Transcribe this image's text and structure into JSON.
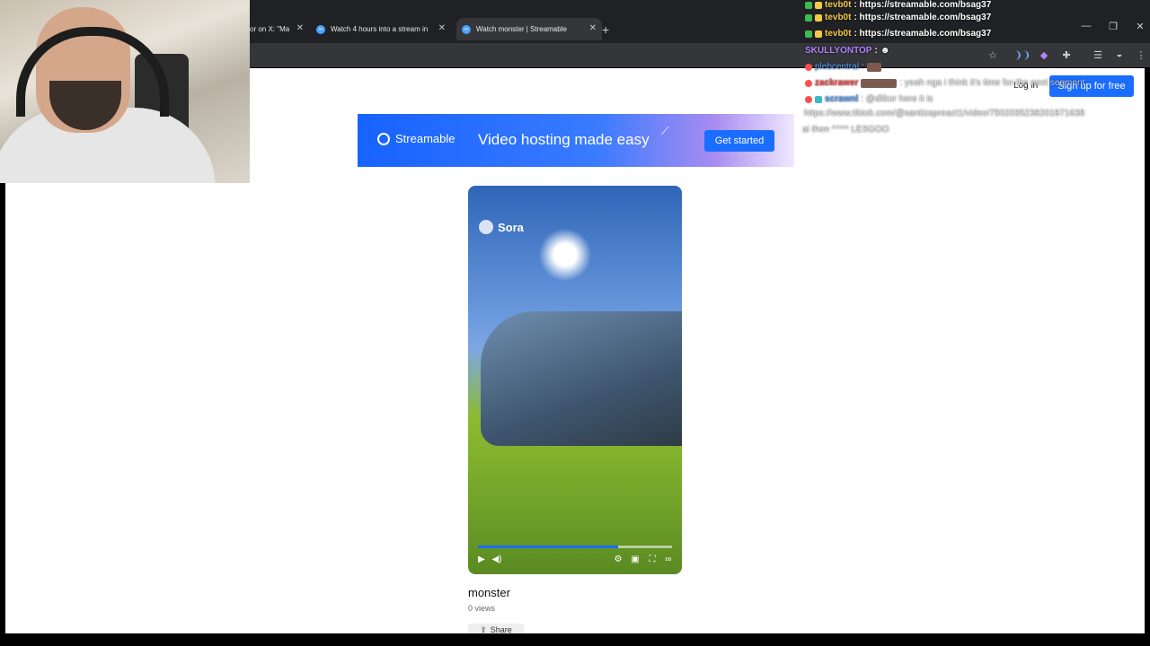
{
  "browser": {
    "tabs": [
      {
        "title": "or on X: \"Ma"
      },
      {
        "title": "Watch 4 hours into a stream in"
      },
      {
        "title": "Watch monster | Streamable"
      }
    ],
    "new_tab_label": "+",
    "window_controls": {
      "minimize": "—",
      "maximize": "❐",
      "close": "✕"
    }
  },
  "banner": {
    "brand": "Streamable",
    "tagline": "Video hosting made easy",
    "cta": "Get started"
  },
  "auth": {
    "login": "Log in",
    "signup": "Sign up for free"
  },
  "video": {
    "watermark": "Sora",
    "title": "monster",
    "views": "0 views",
    "share": "Share",
    "progress_fraction": 0.72
  },
  "chat": {
    "lines": [
      {
        "user": "tevb0t",
        "msg": ": https://streamable.com/bsag37"
      },
      {
        "user": "tevb0t",
        "msg": ": https://streamable.com/bsag37"
      },
      {
        "user": "tevb0t",
        "msg": ": https://streamable.com/bsag37"
      },
      {
        "user": "SKULLYONTOP",
        "msg": ":"
      },
      {
        "user": "plebcentral",
        "msg": ":"
      },
      {
        "user": "zackrawer",
        "msg": ": yeah nga i think it's time for the next segment"
      },
      {
        "user": "scrawnl",
        "msg": ": @dlikor here it is"
      },
      {
        "user": "",
        "msg": "https://www.tiktok.com/@santizapreact1/video/7502035238201871638"
      },
      {
        "user": "",
        "msg": "ai then ^^^^ LESGOO"
      }
    ],
    "colors": {
      "user": "#f2c94c",
      "purple_user": "#b084ff",
      "red_user": "#ff4d4d",
      "blue_user": "#5aa0ff"
    }
  },
  "colors": {
    "accent": "#1a6dff",
    "chrome": "#202124"
  }
}
